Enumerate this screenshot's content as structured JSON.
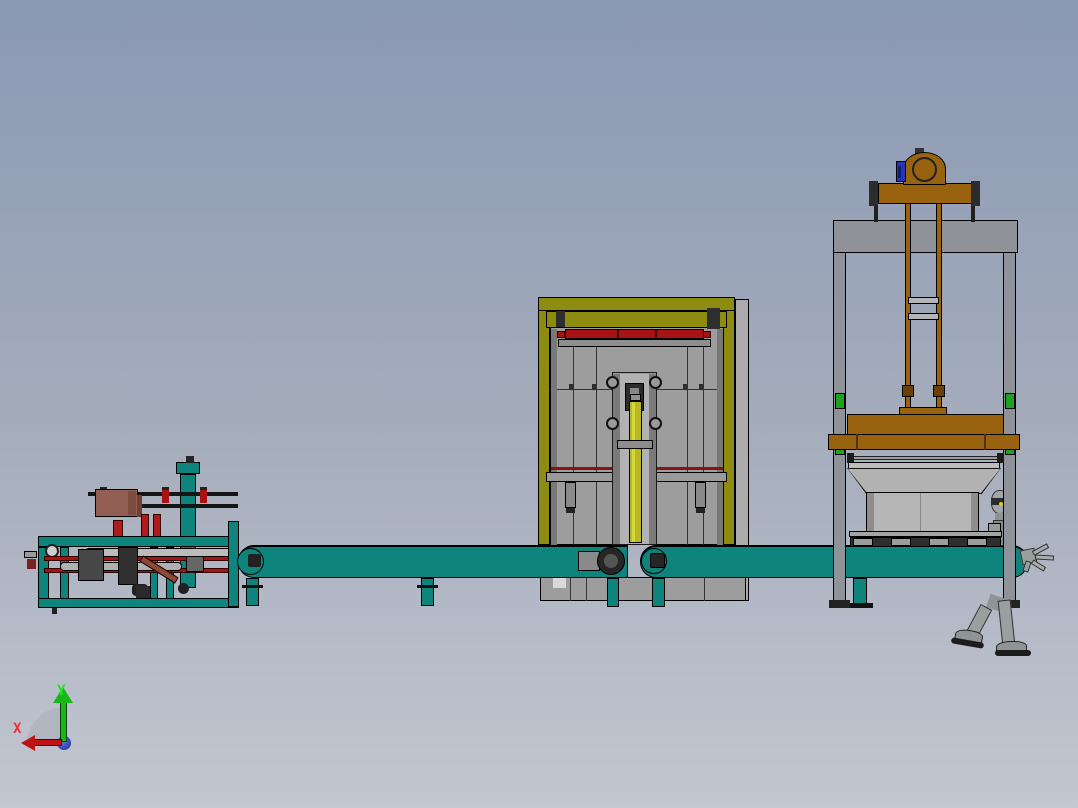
{
  "triad": {
    "x_label": "X",
    "y_label": "Y"
  },
  "palette": {
    "background-top": "#8a99b4",
    "background-mid": "#a6adbc",
    "background-bottom": "#c2c7d1",
    "teal": "#0e847c",
    "olive": "#8e8c10",
    "steel": "#90929a",
    "brown": "#98620f",
    "red": "#a81212",
    "maroon": "#935f55",
    "green": "#1ca21e",
    "yellow": "#b8b922",
    "blue": "#2636b8",
    "panel-gray": "#9d9d9d",
    "axis-x-color": "#f03030",
    "axis-y-color": "#1fe81f",
    "origin-ball-color": "#1a2a90",
    "outline": "#000000"
  }
}
